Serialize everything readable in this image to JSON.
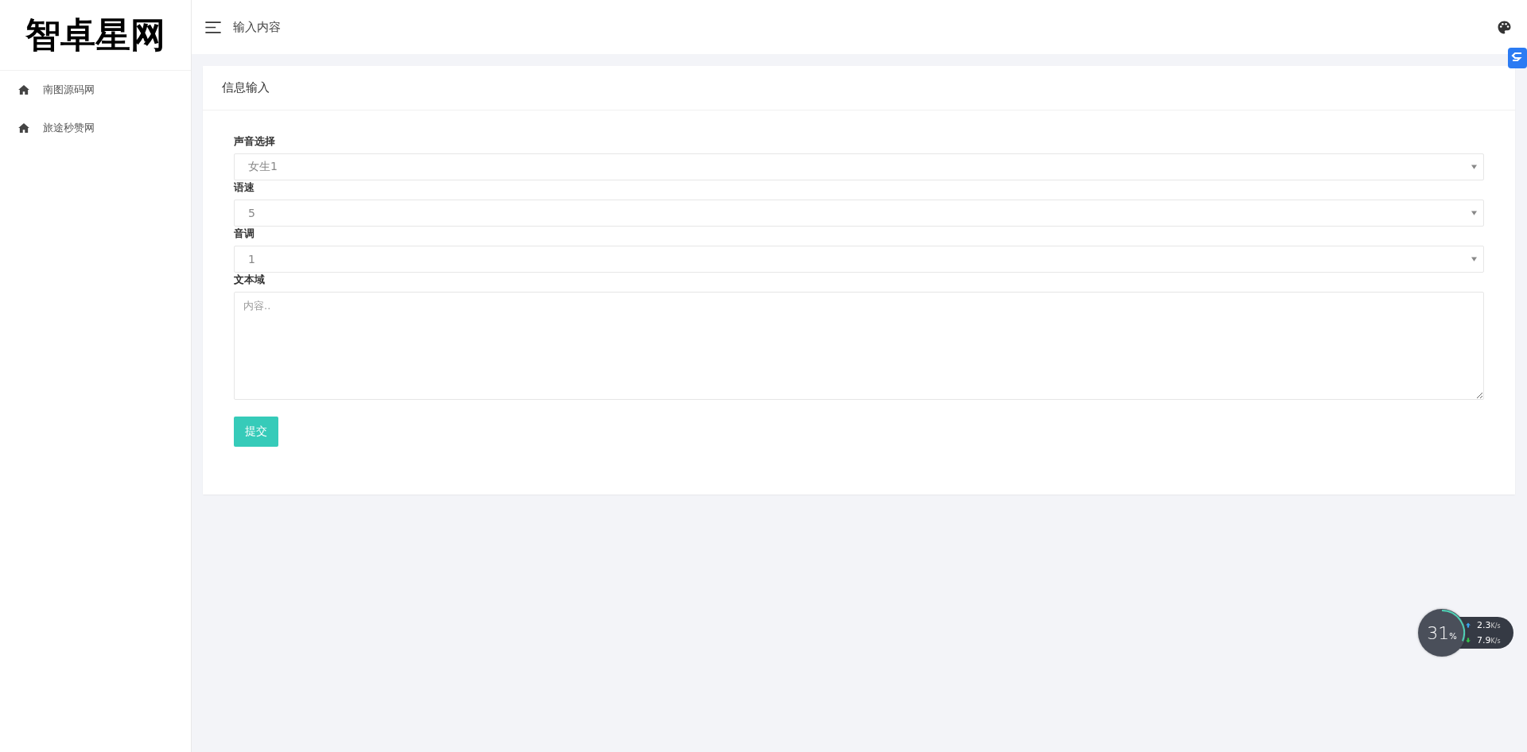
{
  "sidebar": {
    "logo": "智卓星网",
    "items": [
      {
        "label": "南图源码网"
      },
      {
        "label": "旅途秒赞网"
      }
    ]
  },
  "topbar": {
    "title": "输入内容"
  },
  "card": {
    "title": "信息输入",
    "fields": [
      {
        "kind": "select",
        "label": "声音选择",
        "value": "女生1"
      },
      {
        "kind": "select",
        "label": "语速",
        "value": "5"
      },
      {
        "kind": "select",
        "label": "音调",
        "value": "1"
      },
      {
        "kind": "textarea",
        "label": "文本域",
        "placeholder": "内容.."
      }
    ],
    "submit": "提交"
  },
  "net_monitor": {
    "usage": "31",
    "unit": "%",
    "rates": [
      {
        "kind": "up",
        "value": "2.3",
        "unit": "K/s"
      },
      {
        "kind": "down",
        "value": "7.9",
        "unit": "K/s"
      }
    ]
  }
}
